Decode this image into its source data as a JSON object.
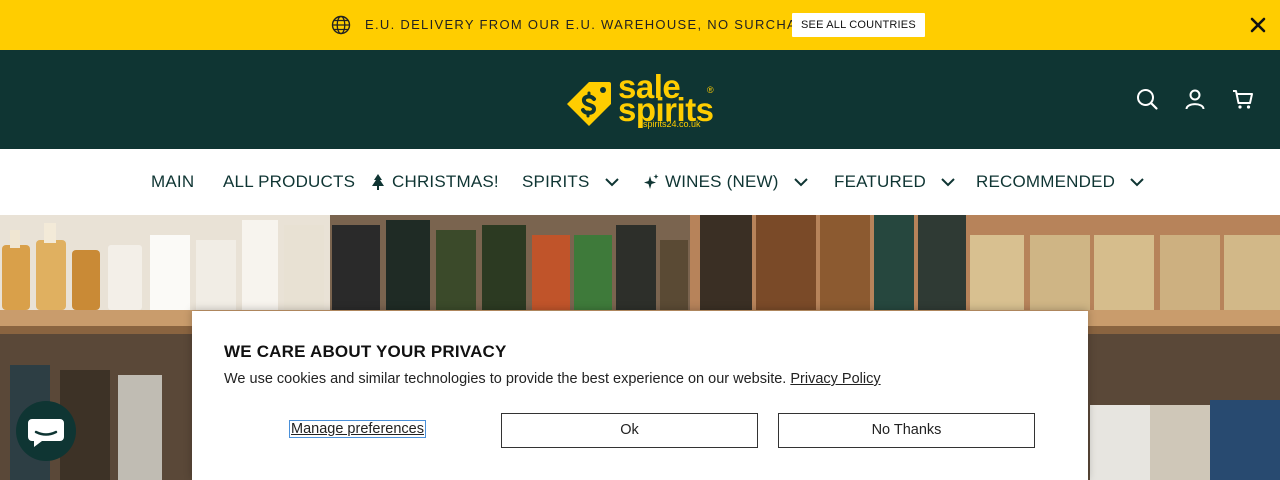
{
  "announcement": {
    "message": "E.U. DELIVERY FROM OUR E.U. WAREHOUSE, NO SURCHARGES.",
    "cta": "SEE ALL COUNTRIES",
    "bg_color": "#ffcd00"
  },
  "header": {
    "bg_color": "#0f3533",
    "logo": {
      "line1": "sale",
      "line2": "spirits",
      "reg": "®",
      "domain": "spirits24.co.uk"
    },
    "icons": [
      "search-icon",
      "account-icon",
      "cart-icon"
    ]
  },
  "nav": {
    "items": [
      {
        "label": "MAIN",
        "has_dropdown": false
      },
      {
        "label": "ALL PRODUCTS",
        "has_dropdown": false
      },
      {
        "label": "CHRISTMAS!",
        "has_dropdown": false,
        "icon": "tree-icon"
      },
      {
        "label": "SPIRITS",
        "has_dropdown": true
      },
      {
        "label": "WINES (NEW)",
        "has_dropdown": true,
        "icon": "sparkle-icon"
      },
      {
        "label": "FEATURED",
        "has_dropdown": true
      },
      {
        "label": "RECOMMENDED",
        "has_dropdown": true
      }
    ]
  },
  "consent": {
    "title": "WE CARE ABOUT YOUR PRIVACY",
    "body": "We use cookies and similar technologies to provide the best experience on our website.",
    "link": "Privacy Policy",
    "manage": "Manage preferences",
    "ok": "Ok",
    "decline": "No Thanks"
  }
}
